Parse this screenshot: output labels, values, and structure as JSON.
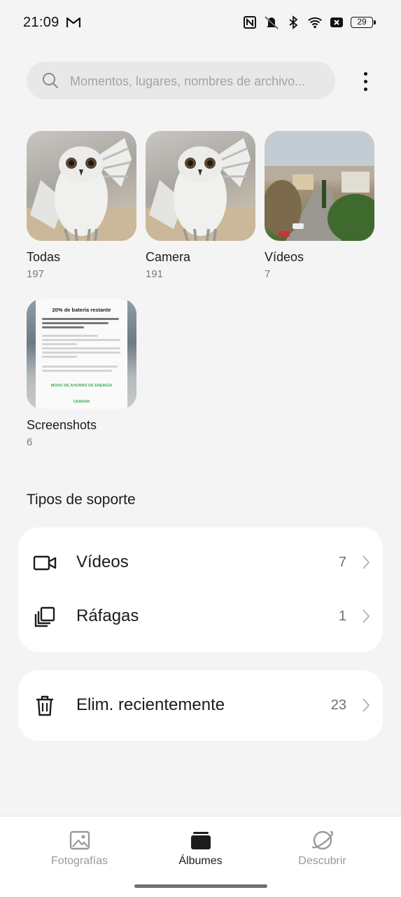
{
  "status_bar": {
    "time": "21:09",
    "battery": "29",
    "icons": [
      "gmail-icon",
      "nfc-icon",
      "vibrate-off-icon",
      "bluetooth-icon",
      "wifi-icon",
      "sim-x-icon",
      "battery-icon"
    ]
  },
  "search": {
    "placeholder": "Momentos, lugares, nombres de archivo..."
  },
  "albums": [
    {
      "name": "Todas",
      "count": "197",
      "thumb": "owl"
    },
    {
      "name": "Camera",
      "count": "191",
      "thumb": "owl"
    },
    {
      "name": "Vídeos",
      "count": "7",
      "thumb": "landscape"
    },
    {
      "name": "Screenshots",
      "count": "6",
      "thumb": "screenshot"
    }
  ],
  "screenshot_thumb": {
    "title": "20% de batería restante",
    "intro": "Activa el Modo de ahorro de batería para implementar las siguientes optimizaciones:",
    "items": [
      "Reducir el brillo de la pantalla",
      "Reducir el tiempo automático de apagado de la pantalla",
      "Desactivar la sincronización en segundo plano",
      "Reducir frecuencia de actualización de la pantalla"
    ],
    "note": "Para acceder a más ajustes, vaya a \"Ajustes - Batería - Modo de ahorro de batería\".",
    "button_1": "MODO DE AHORRO DE ENERGÍA",
    "button_2": "CERRAR"
  },
  "media_types": {
    "title": "Tipos de soporte",
    "rows": [
      {
        "label": "Vídeos",
        "count": "7",
        "icon": "video-camera-icon"
      },
      {
        "label": "Ráfagas",
        "count": "1",
        "icon": "burst-icon"
      }
    ]
  },
  "recently_deleted": {
    "label": "Elim. recientemente",
    "count": "23",
    "icon": "trash-icon"
  },
  "bottom_nav": {
    "items": [
      {
        "label": "Fotografías",
        "icon": "photo-icon",
        "active": false
      },
      {
        "label": "Álbumes",
        "icon": "albums-icon",
        "active": true
      },
      {
        "label": "Descubrir",
        "icon": "planet-icon",
        "active": false
      }
    ]
  },
  "colors": {
    "background": "#f4f4f4",
    "card": "#ffffff",
    "search_bg": "#e8e8e8",
    "accent_green": "#3fae5a",
    "inactive_text": "#9a9a9a"
  }
}
